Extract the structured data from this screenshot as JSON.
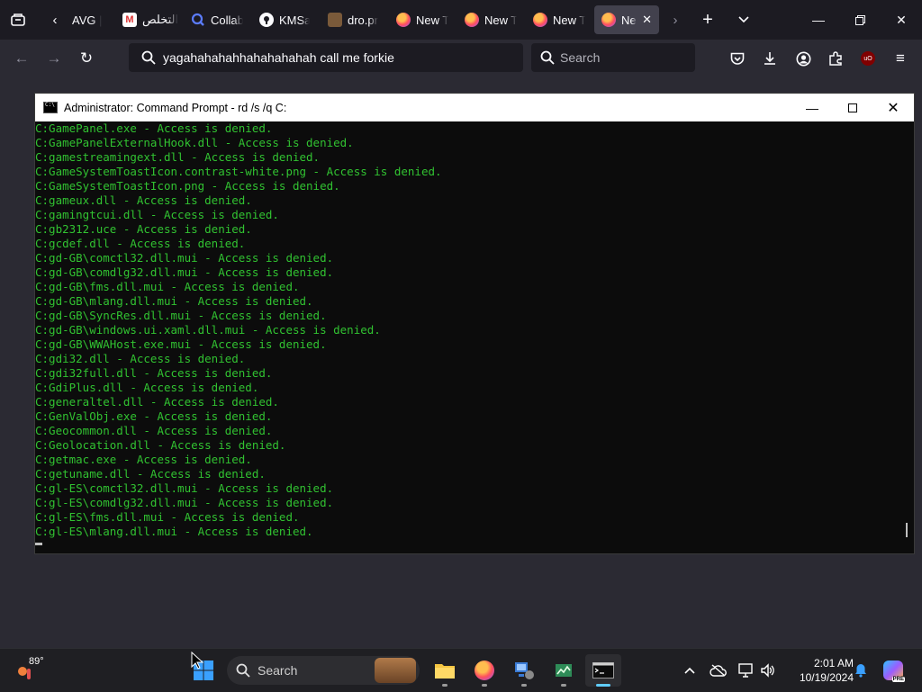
{
  "browser": {
    "tabs": [
      {
        "label": "AVG |",
        "icon": "none"
      },
      {
        "label": "التخلص",
        "icon": "gmail-icon"
      },
      {
        "label": "Collab",
        "icon": "search-icon"
      },
      {
        "label": "KMSa",
        "icon": "github-icon"
      },
      {
        "label": "dro.pr",
        "icon": "folder-icon"
      },
      {
        "label": "New T",
        "icon": "firefox-icon"
      },
      {
        "label": "New T",
        "icon": "firefox-icon"
      },
      {
        "label": "New T",
        "icon": "firefox-icon"
      },
      {
        "label": "Ne",
        "icon": "firefox-icon",
        "active": true
      }
    ],
    "url": "yagahahahahhahahahahah call me forkie",
    "search_placeholder": "Search",
    "accent": "#fbfbfe"
  },
  "cmd": {
    "title": "Administrator: Command Prompt - rd  /s /q C:",
    "text_color": "#31c231",
    "lines": [
      "C:GamePanel.exe - Access is denied.",
      "C:GamePanelExternalHook.dll - Access is denied.",
      "C:gamestreamingext.dll - Access is denied.",
      "C:GameSystemToastIcon.contrast-white.png - Access is denied.",
      "C:GameSystemToastIcon.png - Access is denied.",
      "C:gameux.dll - Access is denied.",
      "C:gamingtcui.dll - Access is denied.",
      "C:gb2312.uce - Access is denied.",
      "C:gcdef.dll - Access is denied.",
      "C:gd-GB\\comctl32.dll.mui - Access is denied.",
      "C:gd-GB\\comdlg32.dll.mui - Access is denied.",
      "C:gd-GB\\fms.dll.mui - Access is denied.",
      "C:gd-GB\\mlang.dll.mui - Access is denied.",
      "C:gd-GB\\SyncRes.dll.mui - Access is denied.",
      "C:gd-GB\\windows.ui.xaml.dll.mui - Access is denied.",
      "C:gd-GB\\WWAHost.exe.mui - Access is denied.",
      "C:gdi32.dll - Access is denied.",
      "C:gdi32full.dll - Access is denied.",
      "C:GdiPlus.dll - Access is denied.",
      "C:generaltel.dll - Access is denied.",
      "C:GenValObj.exe - Access is denied.",
      "C:Geocommon.dll - Access is denied.",
      "C:Geolocation.dll - Access is denied.",
      "C:getmac.exe - Access is denied.",
      "C:getuname.dll - Access is denied.",
      "C:gl-ES\\comctl32.dll.mui - Access is denied.",
      "C:gl-ES\\comdlg32.dll.mui - Access is denied.",
      "C:gl-ES\\fms.dll.mui - Access is denied.",
      "C:gl-ES\\mlang.dll.mui - Access is denied."
    ]
  },
  "taskbar": {
    "weather_temp": "89°",
    "search_label": "Search",
    "time": "2:01 AM",
    "date": "10/19/2024",
    "accent": "#60cdff"
  }
}
